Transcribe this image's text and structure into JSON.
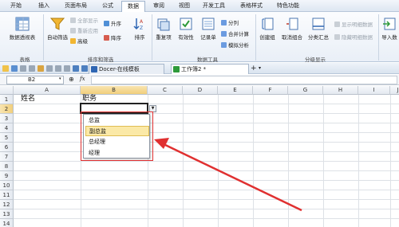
{
  "menu": {
    "tabs": [
      {
        "label": "开始",
        "active": false
      },
      {
        "label": "插入",
        "active": false
      },
      {
        "label": "页面布局",
        "active": false
      },
      {
        "label": "公式",
        "active": false
      },
      {
        "label": "数据",
        "active": true
      },
      {
        "label": "审阅",
        "active": false
      },
      {
        "label": "视图",
        "active": false
      },
      {
        "label": "开发工具",
        "active": false
      },
      {
        "label": "表格样式",
        "active": false
      },
      {
        "label": "特色功能",
        "active": false
      }
    ]
  },
  "ribbon": {
    "pivot": "数据透视表",
    "autofilter": "自动筛选",
    "show_all": "全部显示",
    "reapply": "重新应用",
    "advanced": "高级",
    "sort_asc": "升序",
    "sort_desc": "降序",
    "sort": "排序",
    "duplicates": "重复项",
    "validity": "有效性",
    "record": "记录单",
    "split": "分列",
    "consolidate": "合并计算",
    "whatif": "模拟分析",
    "create_group": "创建组",
    "ungroup": "取消组合",
    "subtotal": "分类汇总",
    "show_detail": "显示明细数据",
    "hide_detail": "隐藏明细数据",
    "import": "导入数",
    "groups": {
      "table": "表格",
      "sort_filter": "排序和筛选",
      "data_tools": "数据工具",
      "outline": "分级显示"
    }
  },
  "docbar": {
    "tab1": "Docer-在线模板",
    "tab2": "工作簿2 *",
    "add": "+"
  },
  "formula": {
    "namebox": "B2",
    "fx": "fx"
  },
  "sheet": {
    "columns": [
      "A",
      "B",
      "C",
      "D",
      "E",
      "F",
      "G",
      "H",
      "I",
      "J"
    ],
    "rows": [
      "1",
      "2",
      "3",
      "4",
      "5",
      "6",
      "7",
      "8",
      "9",
      "10",
      "11",
      "12",
      "13",
      "14",
      "15"
    ],
    "cells": {
      "A1": "姓名",
      "B1": "职务"
    }
  },
  "dropdown": {
    "options": [
      "总监",
      "副总监",
      "总经理",
      "经理"
    ],
    "highlighted_index": 1
  },
  "colors": {
    "annotation": "#e03030",
    "highlight": "#fbe9a7",
    "selected_header": "#f1cf7c"
  }
}
